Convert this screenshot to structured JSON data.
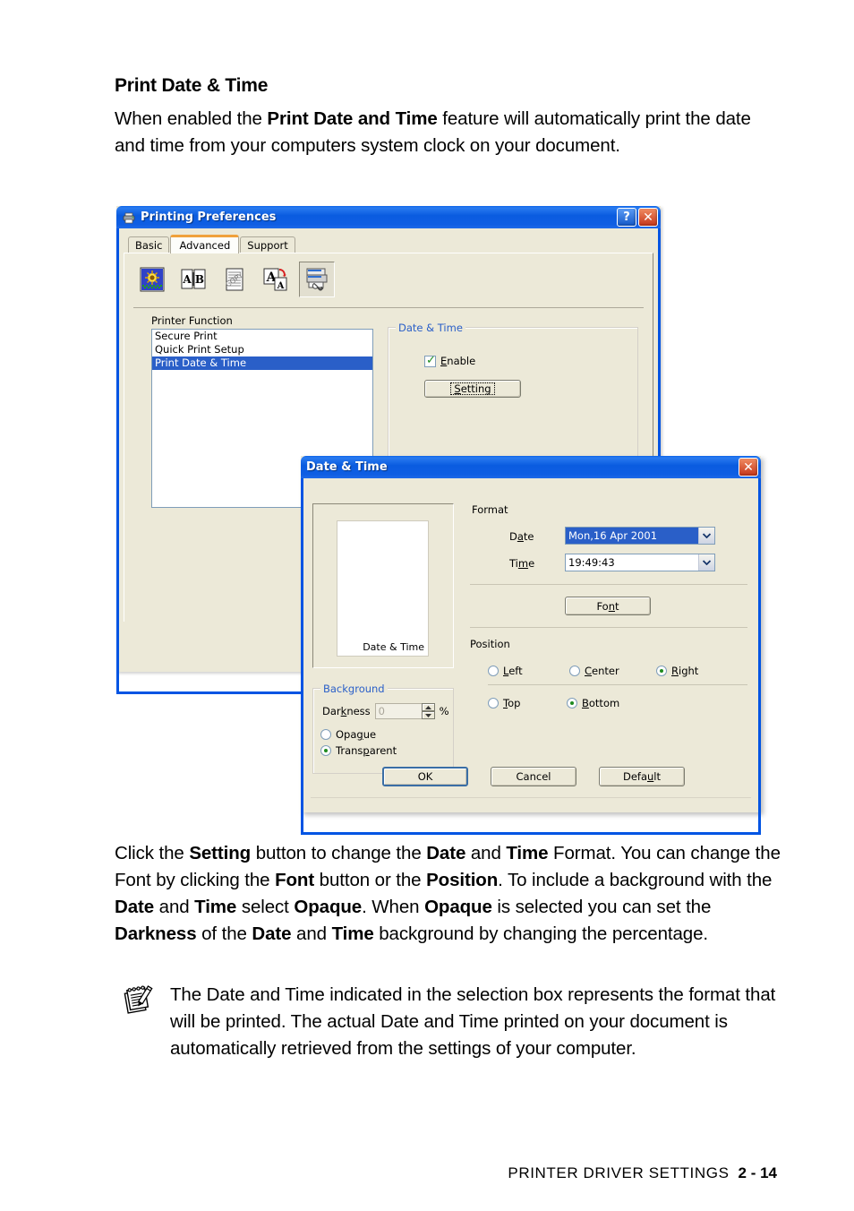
{
  "document": {
    "heading": "Print Date & Time",
    "intro_html": "When enabled the <b>Print Date and Time</b> feature will automatically print the date and time from your computers system clock on your document.",
    "click_html": "Click the <b>Setting</b> button to change the <b>Date</b> and <b>Time</b> Format. You can change the Font by clicking the <b>Font</b> button or the <b>Position</b>. To include a background with the <b>Date</b> and <b>Time</b> select <b>Opaque</b>. When <b>Opaque</b> is selected you can set the <b>Darkness</b> of the <b>Date</b> and <b>Time</b> background by changing the percentage.",
    "note_text": "The Date and Time indicated in the selection box represents the format that will be printed. The actual Date and Time printed on your document is automatically retrieved from the settings of your computer.",
    "footer_label": "PRINTER DRIVER SETTINGS",
    "footer_page": "2 - 14"
  },
  "printing_preferences": {
    "title": "Printing Preferences",
    "title_icon": "printer-icon",
    "help_button": "?",
    "close_button": "✕",
    "tabs": [
      {
        "label": "Basic",
        "selected": false
      },
      {
        "label": "Advanced",
        "selected": true
      },
      {
        "label": "Support",
        "selected": false
      }
    ],
    "toolbar": [
      {
        "name": "watermark-icon",
        "pressed": false
      },
      {
        "name": "duplex-icon",
        "pressed": false
      },
      {
        "name": "copy-pages-icon",
        "pressed": false
      },
      {
        "name": "page-scaling-icon",
        "pressed": false
      },
      {
        "name": "printer-function-icon",
        "pressed": true
      }
    ],
    "printer_function_label": "Printer Function",
    "printer_function_items": [
      {
        "label": "Secure Print",
        "selected": false
      },
      {
        "label": "Quick Print Setup",
        "selected": false
      },
      {
        "label": "Print Date & Time",
        "selected": true
      }
    ],
    "date_time_group": {
      "title": "Date & Time",
      "enable_label": "Enable",
      "enable_checked": true,
      "setting_button": "Setting"
    }
  },
  "date_time_dialog": {
    "title": "Date & Time",
    "close_button": "✕",
    "preview_stamp": "Date & Time",
    "format_label": "Format",
    "date_label": "Date",
    "date_value": "Mon,16 Apr 2001",
    "time_label": "Time",
    "time_value": "19:49:43",
    "font_button": "Font",
    "position_label": "Position",
    "position_options": [
      {
        "label": "Left",
        "checked": false
      },
      {
        "label": "Center",
        "checked": false
      },
      {
        "label": "Right",
        "checked": true
      },
      {
        "label": "Top",
        "checked": false
      },
      {
        "label": "Bottom",
        "checked": true
      }
    ],
    "background_group": {
      "title": "Background",
      "darkness_label": "Darkness",
      "darkness_value": "0",
      "percent_symbol": "%",
      "opaque_label": "Opaque",
      "opaque_checked": false,
      "transparent_label": "Transparent",
      "transparent_checked": true
    },
    "buttons": {
      "ok": "OK",
      "cancel": "Cancel",
      "default": "Default"
    }
  },
  "colors": {
    "titlebar_blue": "#0a5ce0",
    "dialog_face": "#ece9d8",
    "selection_blue": "#2a5fc8",
    "group_title_blue": "#2a5fc8",
    "selected_tab_accent": "#f0a13c",
    "checkmark_green": "#1f8b1f"
  }
}
